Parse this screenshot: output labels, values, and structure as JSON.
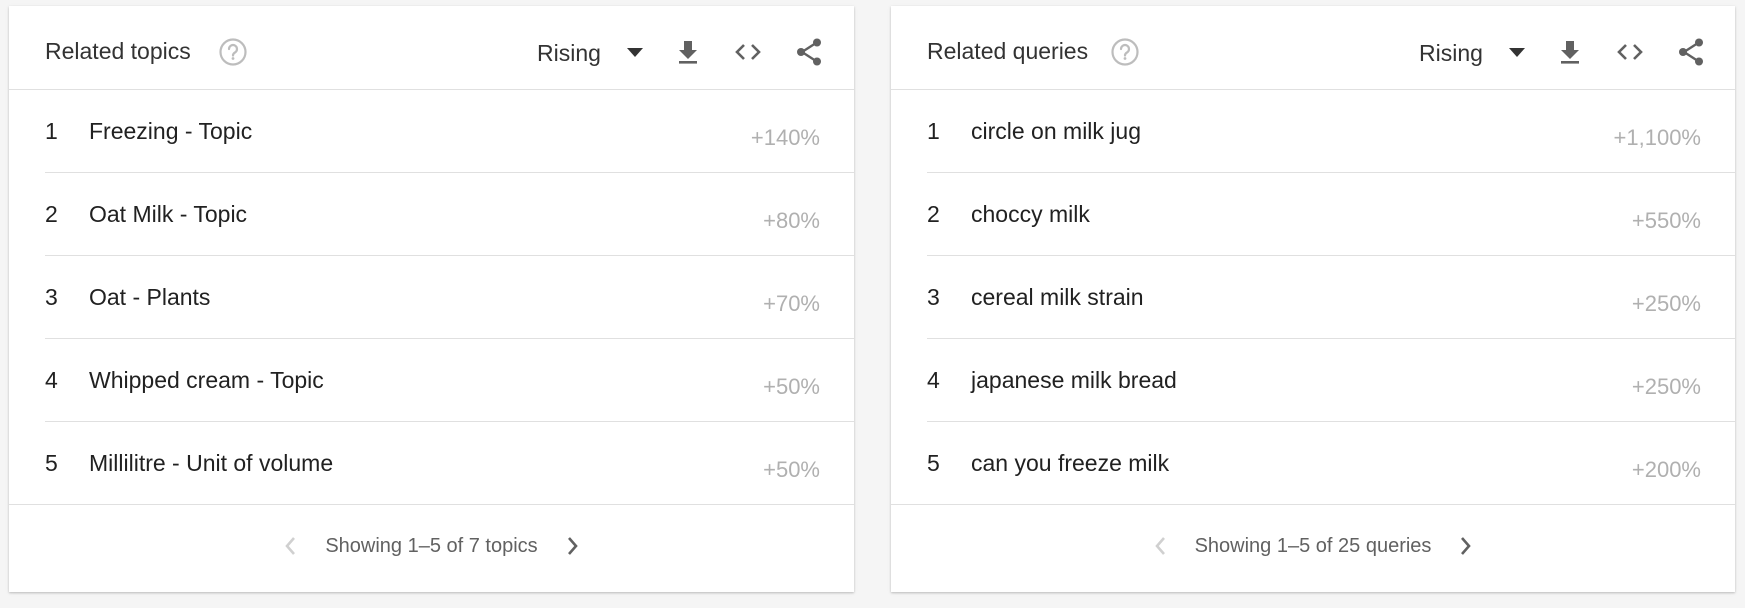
{
  "cards": [
    {
      "title": "Related topics",
      "dropdown": "Rising",
      "rows": [
        {
          "rank": "1",
          "term": "Freezing - Topic",
          "value": "+140%"
        },
        {
          "rank": "2",
          "term": "Oat Milk - Topic",
          "value": "+80%"
        },
        {
          "rank": "3",
          "term": "Oat - Plants",
          "value": "+70%"
        },
        {
          "rank": "4",
          "term": "Whipped cream - Topic",
          "value": "+50%"
        },
        {
          "rank": "5",
          "term": "Millilitre - Unit of volume",
          "value": "+50%"
        }
      ],
      "pagination": "Showing 1–5 of 7 topics"
    },
    {
      "title": "Related queries",
      "dropdown": "Rising",
      "rows": [
        {
          "rank": "1",
          "term": "circle on milk jug",
          "value": "+1,100%"
        },
        {
          "rank": "2",
          "term": "choccy milk",
          "value": "+550%"
        },
        {
          "rank": "3",
          "term": "cereal milk strain",
          "value": "+250%"
        },
        {
          "rank": "4",
          "term": "japanese milk bread",
          "value": "+250%"
        },
        {
          "rank": "5",
          "term": "can you freeze milk",
          "value": "+200%"
        }
      ],
      "pagination": "Showing 1–5 of 25 queries"
    }
  ],
  "icons": {
    "help": "help-circle-icon",
    "dropdown": "triangle-down-icon",
    "download": "download-icon",
    "embed": "code-icon",
    "share": "share-icon",
    "prev": "chevron-left-icon",
    "next": "chevron-right-icon"
  },
  "colors": {
    "icon": "#616161",
    "icon_light": "#bdbdbd",
    "value_text": "#b0b0b0",
    "divider": "#e0e0e0"
  }
}
